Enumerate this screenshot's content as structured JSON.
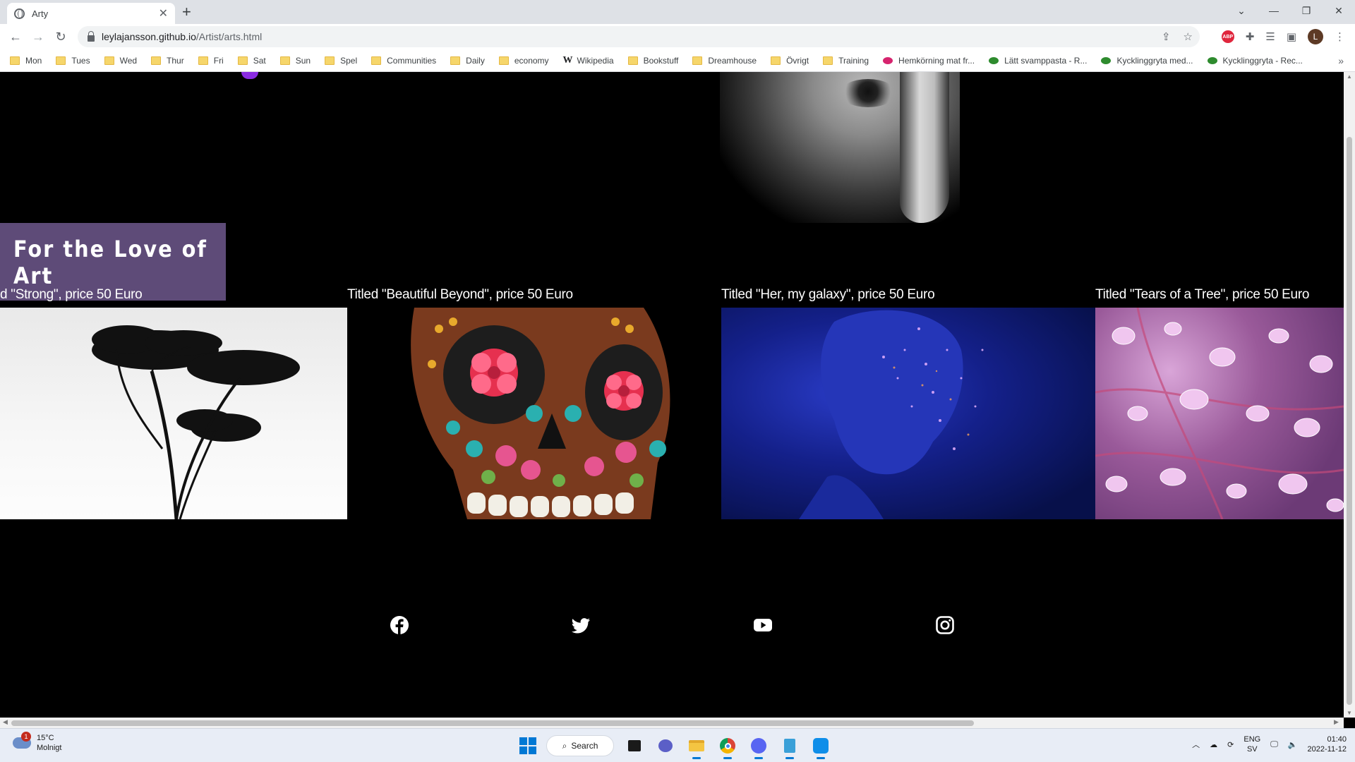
{
  "browser": {
    "tab_title": "Arty",
    "new_tab_icon": "+",
    "url_host": "leylajansson.github.io",
    "url_path": "/Artist/arts.html",
    "profile_initial": "L",
    "abp_label": "ABP"
  },
  "bookmarks": [
    {
      "label": "Mon",
      "icon": "folder-icon"
    },
    {
      "label": "Tues",
      "icon": "folder-icon"
    },
    {
      "label": "Wed",
      "icon": "folder-icon"
    },
    {
      "label": "Thur",
      "icon": "folder-icon"
    },
    {
      "label": "Fri",
      "icon": "folder-icon"
    },
    {
      "label": "Sat",
      "icon": "folder-icon"
    },
    {
      "label": "Sun",
      "icon": "folder-icon"
    },
    {
      "label": "Spel",
      "icon": "folder-icon"
    },
    {
      "label": "Communities",
      "icon": "folder-icon"
    },
    {
      "label": "Daily",
      "icon": "folder-icon"
    },
    {
      "label": "economy",
      "icon": "folder-icon"
    },
    {
      "label": "Wikipedia",
      "icon": "wikipedia-icon"
    },
    {
      "label": "Bookstuff",
      "icon": "folder-icon"
    },
    {
      "label": "Dreamhouse",
      "icon": "folder-icon"
    },
    {
      "label": "Övrigt",
      "icon": "folder-icon"
    },
    {
      "label": "Training",
      "icon": "folder-icon"
    },
    {
      "label": "Hemkörning mat fr...",
      "icon": "site-icon",
      "color": "#d6246e"
    },
    {
      "label": "Lätt svamppasta - R...",
      "icon": "site-icon",
      "color": "#2e8b2e"
    },
    {
      "label": "Kycklinggryta med...",
      "icon": "site-icon",
      "color": "#2e8b2e"
    },
    {
      "label": "Kycklinggryta - Rec...",
      "icon": "site-icon",
      "color": "#2e8b2e"
    }
  ],
  "page": {
    "section_title": "For the Love of Art",
    "accent_color": "#5e4b78",
    "artworks": [
      {
        "caption": "d \"Strong\", price 50 Euro",
        "image": "tree-image"
      },
      {
        "caption": "Titled \"Beautiful Beyond\", price 50 Euro",
        "image": "sugar-skull-image"
      },
      {
        "caption": "Titled \"Her, my galaxy\", price 50 Euro",
        "image": "galaxy-face-image"
      },
      {
        "caption": "Titled \"Tears of a Tree\", price 50 Euro",
        "image": "leaf-drops-image"
      }
    ],
    "social": [
      "facebook-icon",
      "twitter-icon",
      "youtube-icon",
      "instagram-icon"
    ]
  },
  "taskbar": {
    "weather_badge": "1",
    "temperature": "15°C",
    "condition": "Molnigt",
    "search_label": "Search",
    "lang_primary": "ENG",
    "lang_secondary": "SV",
    "time": "01:40",
    "date": "2022-11-12"
  }
}
